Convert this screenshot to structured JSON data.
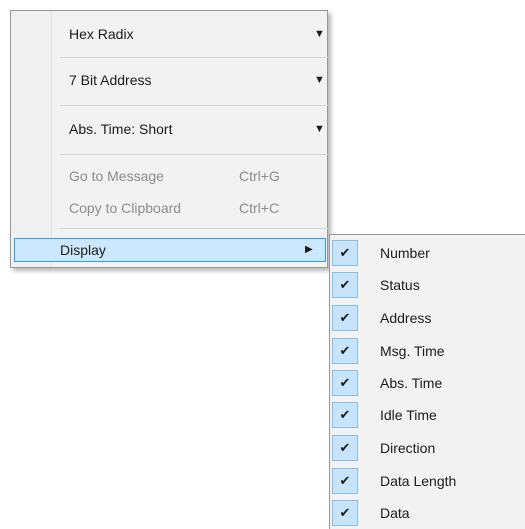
{
  "menu": {
    "combos": [
      {
        "label": "Hex Radix"
      },
      {
        "label": "7 Bit Address"
      },
      {
        "label": "Abs. Time: Short"
      }
    ],
    "commands": [
      {
        "label": "Go to Message",
        "shortcut": "Ctrl+G",
        "enabled": false
      },
      {
        "label": "Copy to Clipboard",
        "shortcut": "Ctrl+C",
        "enabled": false
      }
    ],
    "display": {
      "label": "Display",
      "highlighted": true
    }
  },
  "submenu": {
    "items": [
      {
        "label": "Number",
        "checked": true
      },
      {
        "label": "Status",
        "checked": true
      },
      {
        "label": "Address",
        "checked": true
      },
      {
        "label": "Msg. Time",
        "checked": true
      },
      {
        "label": "Abs. Time",
        "checked": true
      },
      {
        "label": "Idle Time",
        "checked": true
      },
      {
        "label": "Direction",
        "checked": true
      },
      {
        "label": "Data Length",
        "checked": true
      },
      {
        "label": "Data",
        "checked": true
      }
    ]
  },
  "colors": {
    "highlight_fill": "#cce8ff",
    "highlight_border": "#3399ff",
    "check_fill": "#c7e4fb",
    "disabled_text": "#8c8c8c"
  }
}
